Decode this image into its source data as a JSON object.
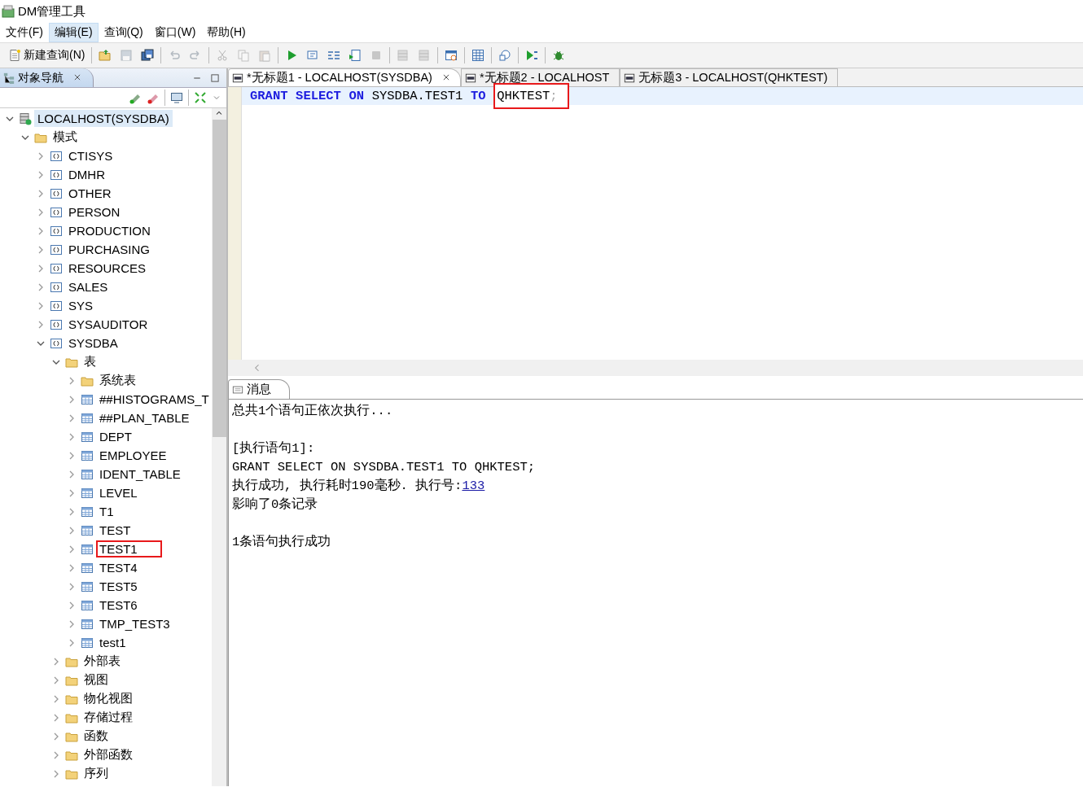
{
  "window": {
    "title": "DM管理工具"
  },
  "menu": [
    {
      "label": "文件(F)",
      "selected": false
    },
    {
      "label": "编辑(E)",
      "selected": true
    },
    {
      "label": "查询(Q)",
      "selected": false
    },
    {
      "label": "窗口(W)",
      "selected": false
    },
    {
      "label": "帮助(H)",
      "selected": false
    }
  ],
  "toolbar": [
    {
      "kind": "new-query",
      "label": "新建查询(N)",
      "disabled": false
    },
    {
      "kind": "sep"
    },
    {
      "kind": "open",
      "disabled": false
    },
    {
      "kind": "save",
      "disabled": true
    },
    {
      "kind": "save-all",
      "disabled": false
    },
    {
      "kind": "sep"
    },
    {
      "kind": "undo",
      "disabled": true
    },
    {
      "kind": "redo",
      "disabled": true
    },
    {
      "kind": "sep"
    },
    {
      "kind": "cut",
      "disabled": true
    },
    {
      "kind": "copy",
      "disabled": true
    },
    {
      "kind": "paste",
      "disabled": true
    },
    {
      "kind": "sep"
    },
    {
      "kind": "run",
      "disabled": false
    },
    {
      "kind": "run-step",
      "disabled": false
    },
    {
      "kind": "explain",
      "disabled": false
    },
    {
      "kind": "run-script",
      "disabled": false
    },
    {
      "kind": "stop",
      "disabled": true
    },
    {
      "kind": "sep"
    },
    {
      "kind": "db",
      "disabled": true
    },
    {
      "kind": "db",
      "disabled": true
    },
    {
      "kind": "sep"
    },
    {
      "kind": "schedule",
      "disabled": false
    },
    {
      "kind": "sep"
    },
    {
      "kind": "grid",
      "disabled": false
    },
    {
      "kind": "sep"
    },
    {
      "kind": "history",
      "disabled": false
    },
    {
      "kind": "sep"
    },
    {
      "kind": "debug-run",
      "disabled": false
    },
    {
      "kind": "sep"
    },
    {
      "kind": "bug",
      "disabled": false
    }
  ],
  "navigator": {
    "title": "对象导航",
    "tree": [
      {
        "label": "LOCALHOST(SYSDBA)",
        "kind": "server",
        "expanded": true,
        "selected": true,
        "highlighted": false,
        "children": [
          {
            "label": "模式",
            "kind": "folder",
            "expanded": true,
            "selected": false,
            "highlighted": false,
            "children": [
              {
                "label": "CTISYS",
                "kind": "schema",
                "expanded": false,
                "selected": false,
                "highlighted": false
              },
              {
                "label": "DMHR",
                "kind": "schema",
                "expanded": false,
                "selected": false,
                "highlighted": false
              },
              {
                "label": "OTHER",
                "kind": "schema",
                "expanded": false,
                "selected": false,
                "highlighted": false
              },
              {
                "label": "PERSON",
                "kind": "schema",
                "expanded": false,
                "selected": false,
                "highlighted": false
              },
              {
                "label": "PRODUCTION",
                "kind": "schema",
                "expanded": false,
                "selected": false,
                "highlighted": false
              },
              {
                "label": "PURCHASING",
                "kind": "schema",
                "expanded": false,
                "selected": false,
                "highlighted": false
              },
              {
                "label": "RESOURCES",
                "kind": "schema",
                "expanded": false,
                "selected": false,
                "highlighted": false
              },
              {
                "label": "SALES",
                "kind": "schema",
                "expanded": false,
                "selected": false,
                "highlighted": false
              },
              {
                "label": "SYS",
                "kind": "schema",
                "expanded": false,
                "selected": false,
                "highlighted": false
              },
              {
                "label": "SYSAUDITOR",
                "kind": "schema",
                "expanded": false,
                "selected": false,
                "highlighted": false
              },
              {
                "label": "SYSDBA",
                "kind": "schema",
                "expanded": true,
                "selected": false,
                "highlighted": false,
                "children": [
                  {
                    "label": "表",
                    "kind": "folder",
                    "expanded": true,
                    "selected": false,
                    "highlighted": false,
                    "children": [
                      {
                        "label": "系统表",
                        "kind": "folder",
                        "expanded": false,
                        "selected": false,
                        "highlighted": false
                      },
                      {
                        "label": "##HISTOGRAMS_T",
                        "kind": "table",
                        "expanded": false,
                        "selected": false,
                        "highlighted": false
                      },
                      {
                        "label": "##PLAN_TABLE",
                        "kind": "table",
                        "expanded": false,
                        "selected": false,
                        "highlighted": false
                      },
                      {
                        "label": "DEPT",
                        "kind": "table",
                        "expanded": false,
                        "selected": false,
                        "highlighted": false
                      },
                      {
                        "label": "EMPLOYEE",
                        "kind": "table",
                        "expanded": false,
                        "selected": false,
                        "highlighted": false
                      },
                      {
                        "label": "IDENT_TABLE",
                        "kind": "table",
                        "expanded": false,
                        "selected": false,
                        "highlighted": false
                      },
                      {
                        "label": "LEVEL",
                        "kind": "table",
                        "expanded": false,
                        "selected": false,
                        "highlighted": false
                      },
                      {
                        "label": "T1",
                        "kind": "table",
                        "expanded": false,
                        "selected": false,
                        "highlighted": false
                      },
                      {
                        "label": "TEST",
                        "kind": "table",
                        "expanded": false,
                        "selected": false,
                        "highlighted": false
                      },
                      {
                        "label": "TEST1",
                        "kind": "table",
                        "expanded": false,
                        "selected": false,
                        "highlighted": true
                      },
                      {
                        "label": "TEST4",
                        "kind": "table",
                        "expanded": false,
                        "selected": false,
                        "highlighted": false
                      },
                      {
                        "label": "TEST5",
                        "kind": "table",
                        "expanded": false,
                        "selected": false,
                        "highlighted": false
                      },
                      {
                        "label": "TEST6",
                        "kind": "table",
                        "expanded": false,
                        "selected": false,
                        "highlighted": false
                      },
                      {
                        "label": "TMP_TEST3",
                        "kind": "table",
                        "expanded": false,
                        "selected": false,
                        "highlighted": false
                      },
                      {
                        "label": "test1",
                        "kind": "table",
                        "expanded": false,
                        "selected": false,
                        "highlighted": false
                      }
                    ]
                  },
                  {
                    "label": "外部表",
                    "kind": "folder",
                    "expanded": false,
                    "selected": false,
                    "highlighted": false
                  },
                  {
                    "label": "视图",
                    "kind": "folder",
                    "expanded": false,
                    "selected": false,
                    "highlighted": false
                  },
                  {
                    "label": "物化视图",
                    "kind": "folder",
                    "expanded": false,
                    "selected": false,
                    "highlighted": false
                  },
                  {
                    "label": "存储过程",
                    "kind": "folder",
                    "expanded": false,
                    "selected": false,
                    "highlighted": false
                  },
                  {
                    "label": "函数",
                    "kind": "folder",
                    "expanded": false,
                    "selected": false,
                    "highlighted": false
                  },
                  {
                    "label": "外部函数",
                    "kind": "folder",
                    "expanded": false,
                    "selected": false,
                    "highlighted": false
                  },
                  {
                    "label": "序列",
                    "kind": "folder",
                    "expanded": false,
                    "selected": false,
                    "highlighted": false
                  }
                ]
              }
            ]
          }
        ]
      }
    ]
  },
  "editor_tabs": [
    {
      "label": "*无标题1 - LOCALHOST(SYSDBA)",
      "selected": true
    },
    {
      "label": "*无标题2 - LOCALHOST",
      "selected": false
    },
    {
      "label": "无标题3 - LOCALHOST(QHKTEST)",
      "selected": false
    }
  ],
  "editor": {
    "tokens": [
      {
        "text": "GRANT",
        "kind": "keyword",
        "highlighted": false
      },
      {
        "text": "SELECT",
        "kind": "keyword",
        "highlighted": false
      },
      {
        "text": "ON",
        "kind": "keyword",
        "highlighted": false
      },
      {
        "text": "SYSDBA.TEST1",
        "kind": "ident",
        "highlighted": false
      },
      {
        "text": "TO",
        "kind": "keyword",
        "highlighted": false
      },
      {
        "text": "QHKTEST",
        "kind": "ident",
        "highlighted": true
      },
      {
        "text": ";",
        "kind": "punct",
        "highlighted": true
      }
    ]
  },
  "messages": {
    "tab": "消息",
    "lines": [
      {
        "kind": "text",
        "parts": [
          {
            "kind": "text",
            "text": "总共1个语句正依次执行..."
          }
        ]
      },
      {
        "kind": "blank"
      },
      {
        "kind": "text",
        "parts": [
          {
            "kind": "text",
            "text": "[执行语句1]:"
          }
        ]
      },
      {
        "kind": "text",
        "parts": [
          {
            "kind": "text",
            "text": "GRANT SELECT ON SYSDBA.TEST1 TO QHKTEST;"
          }
        ]
      },
      {
        "kind": "text",
        "parts": [
          {
            "kind": "text",
            "text": "执行成功, 执行耗时190毫秒. 执行号:"
          },
          {
            "kind": "link",
            "text": "133"
          }
        ]
      },
      {
        "kind": "text",
        "parts": [
          {
            "kind": "text",
            "text": "影响了0条记录"
          }
        ]
      },
      {
        "kind": "blank"
      },
      {
        "kind": "text",
        "parts": [
          {
            "kind": "text",
            "text": "1条语句执行成功"
          }
        ]
      }
    ]
  }
}
